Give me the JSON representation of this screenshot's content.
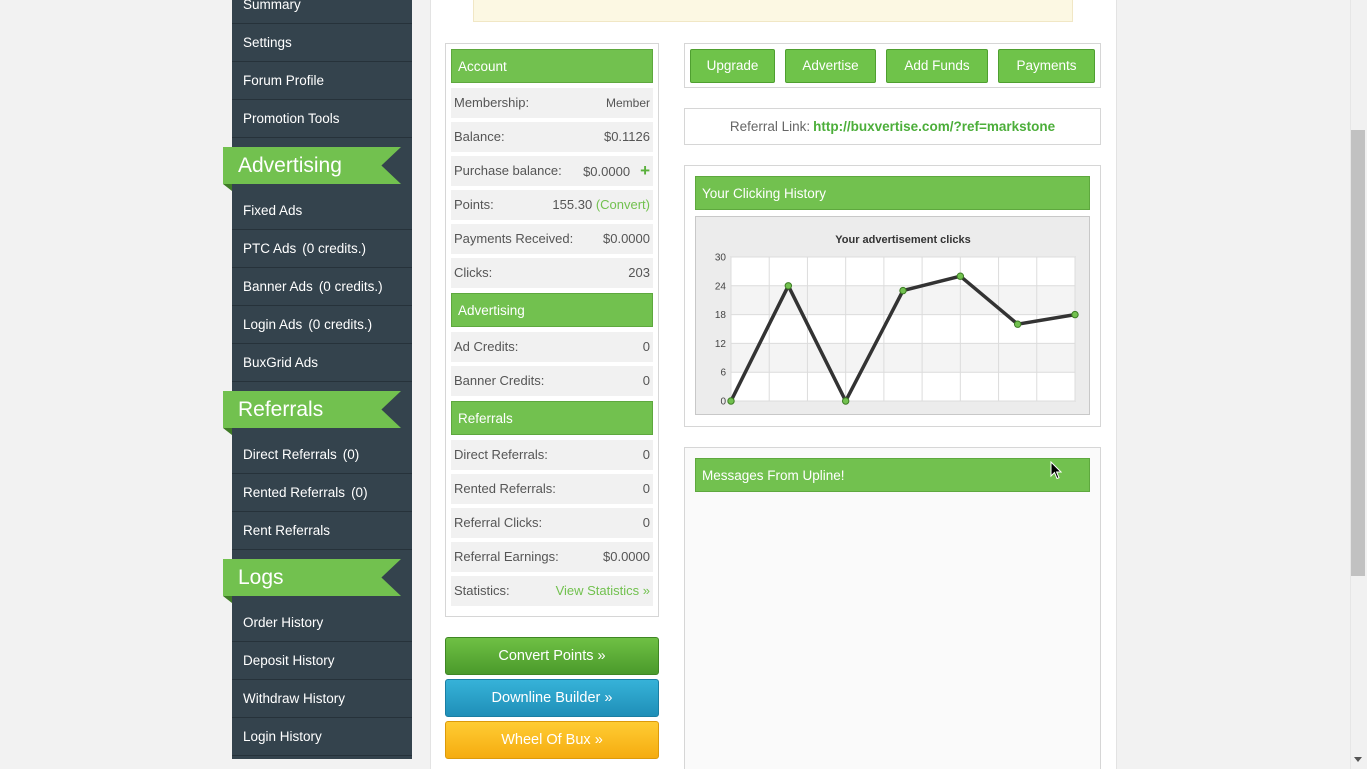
{
  "sidebar": {
    "account_items": [
      {
        "label": "Summary"
      },
      {
        "label": "Settings"
      },
      {
        "label": "Forum Profile"
      },
      {
        "label": "Promotion Tools"
      }
    ],
    "advertising_heading": "Advertising",
    "advertising_items": [
      {
        "label": "Fixed Ads",
        "count": ""
      },
      {
        "label": "PTC Ads",
        "count": "(0 credits.)"
      },
      {
        "label": "Banner Ads",
        "count": "(0 credits.)"
      },
      {
        "label": "Login Ads",
        "count": "(0 credits.)"
      },
      {
        "label": "BuxGrid Ads",
        "count": ""
      }
    ],
    "referrals_heading": "Referrals",
    "referrals_items": [
      {
        "label": "Direct Referrals",
        "count": "(0)"
      },
      {
        "label": "Rented Referrals",
        "count": "(0)"
      },
      {
        "label": "Rent Referrals",
        "count": ""
      }
    ],
    "logs_heading": "Logs",
    "logs_items": [
      {
        "label": "Order History"
      },
      {
        "label": "Deposit History"
      },
      {
        "label": "Withdraw History"
      },
      {
        "label": "Login History"
      }
    ]
  },
  "account_panel": {
    "account_heading": "Account",
    "membership_label": "Membership:",
    "membership_value": "Member",
    "balance_label": "Balance:",
    "balance_value": "$0.1126",
    "purchase_label": "Purchase balance:",
    "purchase_value": "$0.0000",
    "purchase_add": "+",
    "points_label": "Points:",
    "points_value": "155.30",
    "points_convert": "(Convert)",
    "payments_label": "Payments Received:",
    "payments_value": "$0.0000",
    "clicks_label": "Clicks:",
    "clicks_value": "203",
    "advertising_heading": "Advertising",
    "ad_credits_label": "Ad Credits:",
    "ad_credits_value": "0",
    "banner_credits_label": "Banner Credits:",
    "banner_credits_value": "0",
    "referrals_heading": "Referrals",
    "direct_label": "Direct Referrals:",
    "direct_value": "0",
    "rented_label": "Rented Referrals:",
    "rented_value": "0",
    "ref_clicks_label": "Referral Clicks:",
    "ref_clicks_value": "0",
    "ref_earnings_label": "Referral Earnings:",
    "ref_earnings_value": "$0.0000",
    "statistics_label": "Statistics:",
    "statistics_link": "View Statistics »"
  },
  "buttons": {
    "convert": "Convert Points »",
    "downline": "Downline Builder »",
    "wheel": "Wheel Of Bux »",
    "upgrade": "Upgrade",
    "advertise": "Advertise",
    "add_funds": "Add Funds",
    "payments": "Payments"
  },
  "referral": {
    "label": "Referral Link:",
    "url": "http://buxvertise.com/?ref=markstone"
  },
  "history": {
    "heading": "Your Clicking History"
  },
  "messages": {
    "heading": "Messages From Upline!"
  },
  "colors": {
    "green": "#72c14f",
    "sidebar": "#34434d",
    "blue": "#2aa3cb",
    "yellow": "#f9bd22"
  },
  "chart_data": {
    "type": "line",
    "title": "Your advertisement clicks",
    "xlabel": "",
    "ylabel": "",
    "y_ticks": [
      "0",
      "6",
      "12",
      "18",
      "24",
      "30"
    ],
    "ylim": [
      0,
      30
    ],
    "x": [
      0,
      1,
      2,
      3,
      4,
      5,
      6,
      7,
      8,
      9
    ],
    "values": [
      0,
      24,
      null,
      0,
      null,
      23,
      26,
      null,
      16,
      18
    ],
    "points": [
      {
        "i": 0,
        "y": 0
      },
      {
        "i": 1.5,
        "y": 24
      },
      {
        "i": 3,
        "y": 0
      },
      {
        "i": 4.5,
        "y": 23
      },
      {
        "i": 6,
        "y": 26
      },
      {
        "i": 7.5,
        "y": 16
      },
      {
        "i": 9,
        "y": 18
      }
    ],
    "grid": true,
    "line_color": "#333333",
    "marker_color": "#72c14f"
  }
}
